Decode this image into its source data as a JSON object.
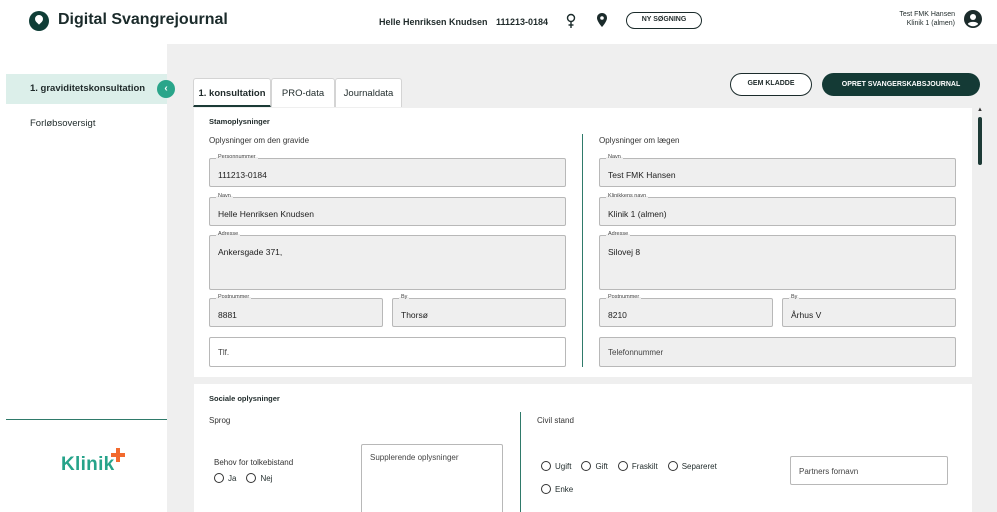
{
  "header": {
    "app_title": "Digital Svangrejournal",
    "patient_name": "Helle Henriksen Knudsen",
    "patient_cpr": "111213-0184",
    "new_search": "NY SØGNING",
    "user_name": "Test FMK Hansen",
    "user_clinic": "Klinik 1 (almen)"
  },
  "sidebar": {
    "items": [
      {
        "label": "1. graviditetskonsultation"
      },
      {
        "label": "Forløbsoversigt"
      }
    ],
    "collapse": "‹",
    "brand": "Klinik"
  },
  "tabs": [
    {
      "label": "1. konsultation"
    },
    {
      "label": "PRO-data"
    },
    {
      "label": "Journaldata"
    }
  ],
  "actions": {
    "save_draft": "GEM KLADDE",
    "create": "OPRET SVANGERSKABSJOURNAL"
  },
  "stam": {
    "title": "Stamoplysninger",
    "gravid_title": "Oplysninger om den gravide",
    "laege_title": "Oplysninger om lægen",
    "gravid": {
      "personnummer_label": "Personnummer",
      "personnummer": "111213-0184",
      "navn_label": "Navn",
      "navn": "Helle Henriksen Knudsen",
      "adresse_label": "Adresse",
      "adresse": "Ankersgade 371,",
      "postnummer_label": "Postnummer",
      "postnummer": "8881",
      "by_label": "By",
      "by": "Thorsø",
      "tlf_placeholder": "Tlf."
    },
    "laege": {
      "navn_label": "Navn",
      "navn": "Test FMK Hansen",
      "klinik_label": "Klinikkens navn",
      "klinik": "Klinik 1 (almen)",
      "adresse_label": "Adresse",
      "adresse": "Silovej 8",
      "postnummer_label": "Postnummer",
      "postnummer": "8210",
      "by_label": "By",
      "by": "Århus V",
      "telefon_placeholder": "Telefonnummer"
    }
  },
  "social": {
    "title": "Sociale oplysninger",
    "sprog": "Sprog",
    "tolk_label": "Behov for tolkebistand",
    "ja": "Ja",
    "nej": "Nej",
    "supplerende": "Supplerende oplysninger",
    "civil_stand": "Civil stand",
    "options": [
      "Ugift",
      "Gift",
      "Fraskilt",
      "Separeret",
      "Enke"
    ],
    "partner_placeholder": "Partners fornavn"
  },
  "colors": {
    "accent": "#2aa58a",
    "dark": "#143a35",
    "active_bg": "#dcefea"
  }
}
